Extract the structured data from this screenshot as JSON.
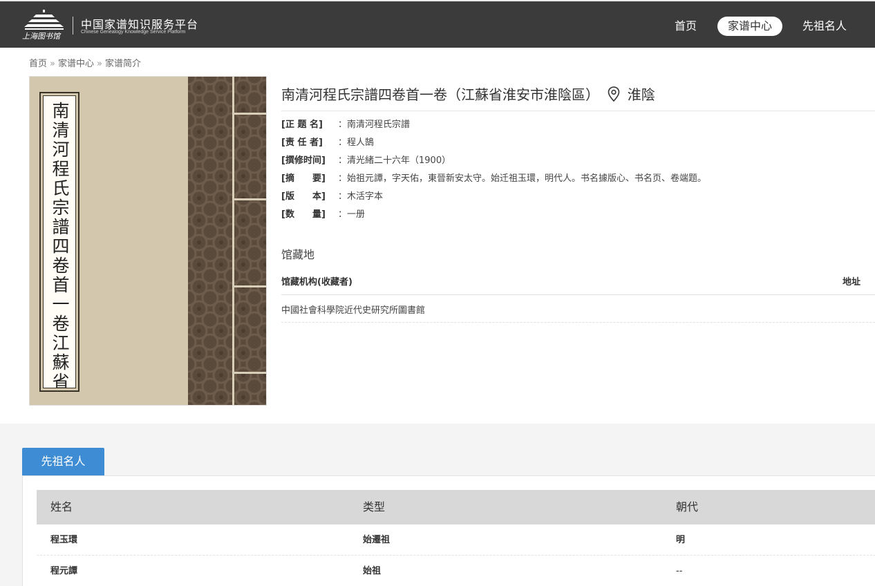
{
  "header": {
    "logo_text": "上海图书馆",
    "brand_cn": "中国家谱知识服务平台",
    "brand_en": "Chinese Genealogy Knowledge Service Platform",
    "nav": [
      "首页",
      "家谱中心",
      "先祖名人"
    ]
  },
  "breadcrumb": {
    "items": [
      "首页",
      "家谱中心",
      "家谱简介"
    ],
    "separator": "»"
  },
  "cover": {
    "title": "南清河程氏宗譜四卷首一卷江蘇省"
  },
  "detail": {
    "title": "南清河程氏宗譜四卷首一卷（江蘇省淮安市淮陰區）",
    "location": "淮陰",
    "fields": [
      {
        "label": "[正 题 名]",
        "value": "：南清河程氏宗譜"
      },
      {
        "label": "[责 任 者]",
        "value": "：程人鵠"
      },
      {
        "label": "[撰修时间]",
        "value": "：清光緒二十六年（1900）"
      },
      {
        "label": "[摘　　要]",
        "value": "：始祖元譚，字天佑，東晉新安太守。始迁祖玉環，明代人。书名據版心、书名页、卷端题。"
      },
      {
        "label": "[版　　本]",
        "value": "：木活字本"
      },
      {
        "label": "[数　　量]",
        "value": "：一册"
      }
    ]
  },
  "holdings": {
    "title": "馆藏地",
    "col_org": "馆藏机构(收藏者)",
    "col_addr": "地址",
    "rows": [
      {
        "org": "中國社會科學院近代史研究所圖書館",
        "addr": ""
      }
    ]
  },
  "ancestors": {
    "tab": "先祖名人",
    "columns": [
      "姓名",
      "类型",
      "朝代"
    ],
    "rows": [
      {
        "name": "程玉環",
        "type": "始遷祖",
        "dynasty": "明"
      },
      {
        "name": "程元譚",
        "type": "始祖",
        "dynasty": "--"
      }
    ]
  },
  "colors": {
    "header_bg": "#3b3b3b",
    "tab_active": "#3e8cd3",
    "table_header_bg": "#d8d8d8"
  }
}
